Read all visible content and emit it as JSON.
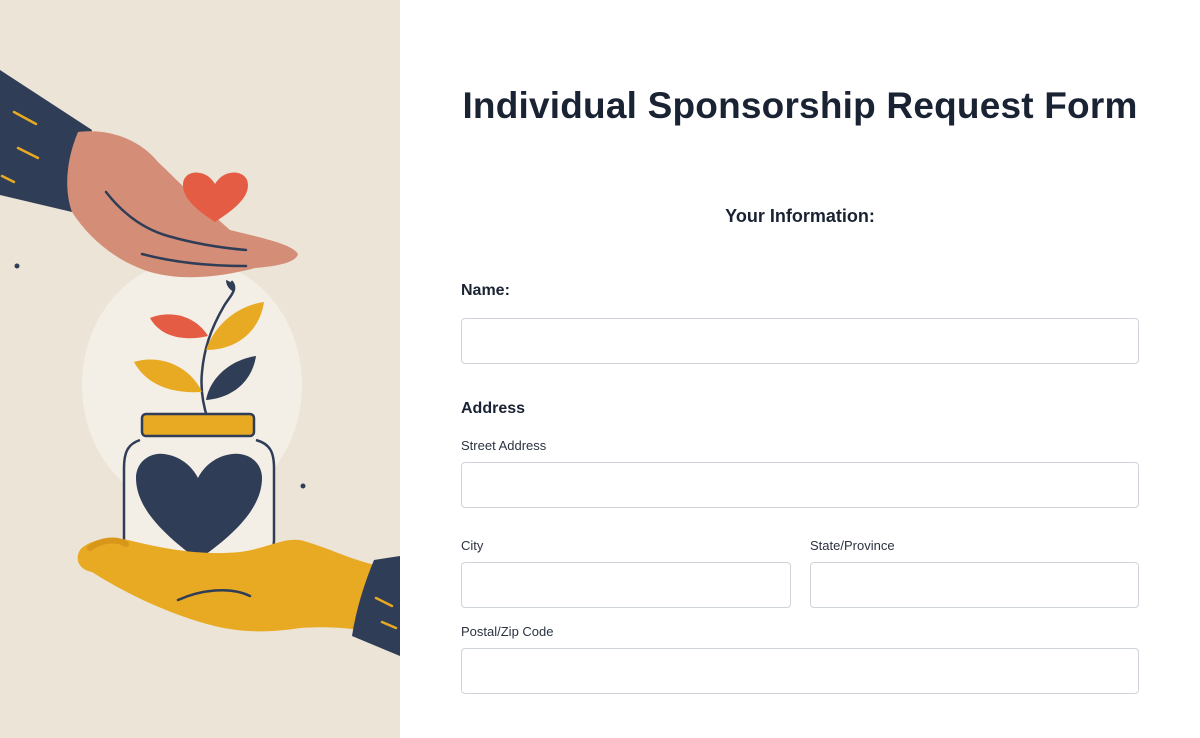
{
  "form": {
    "title": "Individual Sponsorship Request Form",
    "section_title": "Your Information:",
    "name_label": "Name:",
    "name_value": "",
    "address_label": "Address",
    "street_label": "Street Address",
    "street_value": "",
    "city_label": "City",
    "city_value": "",
    "state_label": "State/Province",
    "state_value": "",
    "postal_label": "Postal/Zip Code",
    "postal_value": ""
  },
  "colors": {
    "illustration_bg": "#ebe4d7",
    "navy": "#2f3d57",
    "mustard": "#e8a923",
    "coral": "#e55c44",
    "skin": "#d48d77",
    "title_text": "#1a2333"
  },
  "icons": {
    "heart": "heart-icon",
    "plant": "plant-icon",
    "jar": "donation-jar-icon"
  }
}
